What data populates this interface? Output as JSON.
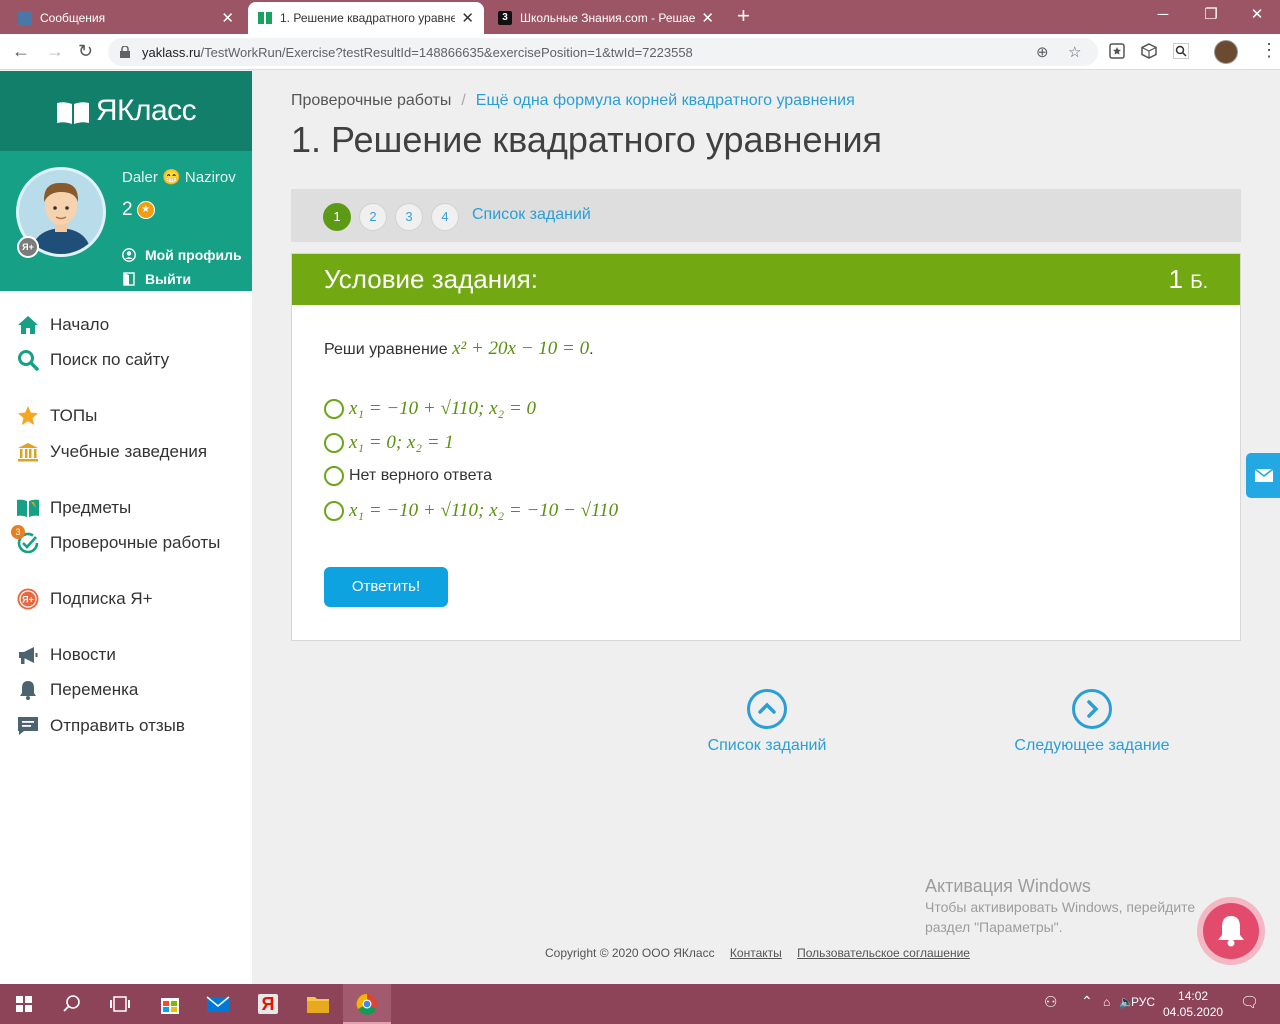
{
  "browser": {
    "tabs": [
      {
        "title": "Сообщения",
        "active": false
      },
      {
        "title": "1. Решение квадратного уравне",
        "active": true
      },
      {
        "title": "Школьные Знания.com - Решае",
        "active": false
      }
    ],
    "new_tab": "+",
    "url_host": "yaklass.ru",
    "url_path": "/TestWorkRun/Exercise?testResultId=148866635&exercisePosition=1&twId=7223558"
  },
  "brand": {
    "logo_text": "ЯКласс"
  },
  "profile": {
    "name_first": "Daler",
    "name_emoji": "😁",
    "name_last": "Nazirov",
    "points": "2",
    "badge": "Я+",
    "my_profile": "Мой профиль",
    "logout": "Выйти"
  },
  "menu": [
    {
      "label": "Начало",
      "icon": "home-icon"
    },
    {
      "label": "Поиск по сайту",
      "icon": "search-icon"
    },
    {
      "label": "ТОПы",
      "icon": "star-icon"
    },
    {
      "label": "Учебные заведения",
      "icon": "institution-icon"
    },
    {
      "label": "Предметы",
      "icon": "book-icon"
    },
    {
      "label": "Проверочные работы",
      "icon": "check-icon",
      "badge": "3"
    },
    {
      "label": "Подписка Я+",
      "icon": "subscription-icon"
    },
    {
      "label": "Новости",
      "icon": "megaphone-icon"
    },
    {
      "label": "Переменка",
      "icon": "bell-icon"
    },
    {
      "label": "Отправить отзыв",
      "icon": "feedback-icon"
    }
  ],
  "breadcrumb": {
    "root": "Проверочные работы",
    "separator": "/",
    "current": "Ещё одна формула корней квадратного уравнения"
  },
  "page": {
    "title": "1. Решение квадратного уравнения"
  },
  "pager": {
    "pages": [
      "1",
      "2",
      "3",
      "4"
    ],
    "active_page": "1",
    "list_link": "Список заданий"
  },
  "task": {
    "header": "Условие задания:",
    "points_value": "1",
    "points_unit": "Б.",
    "question_prefix": "Реши уравнение",
    "question_math": "x² + 20x − 10 = 0",
    "question_suffix": ".",
    "options": [
      {
        "type": "math",
        "text": "x₁ = −10 + √110; x₂ = 0"
      },
      {
        "type": "math",
        "text": "x₁ = 0; x₂ = 1"
      },
      {
        "type": "text",
        "text": "Нет верного ответа"
      },
      {
        "type": "math",
        "text": "x₁ = −10 + √110; x₂ = −10 − √110"
      }
    ],
    "submit": "Ответить!"
  },
  "bottom_nav": {
    "list": "Список заданий",
    "next": "Следующее задание"
  },
  "windows_activation": {
    "title": "Активация Windows",
    "line1": "Чтобы активировать Windows, перейдите",
    "line2": "раздел \"Параметры\"."
  },
  "footer": {
    "copyright": "Copyright © 2020 ООО ЯКласс",
    "contacts": "Контакты",
    "agreement": "Пользовательское соглашение"
  },
  "taskbar": {
    "lang": "РУС",
    "time": "14:02",
    "date": "04.05.2020"
  },
  "colors": {
    "tab_strip": "#9c5565",
    "sidebar_dark": "#127f6a",
    "sidebar_green": "#16a085",
    "task_header": "#72a812",
    "link": "#2a9fd6",
    "button": "#0fa2e0",
    "taskbar": "#8d4458"
  }
}
